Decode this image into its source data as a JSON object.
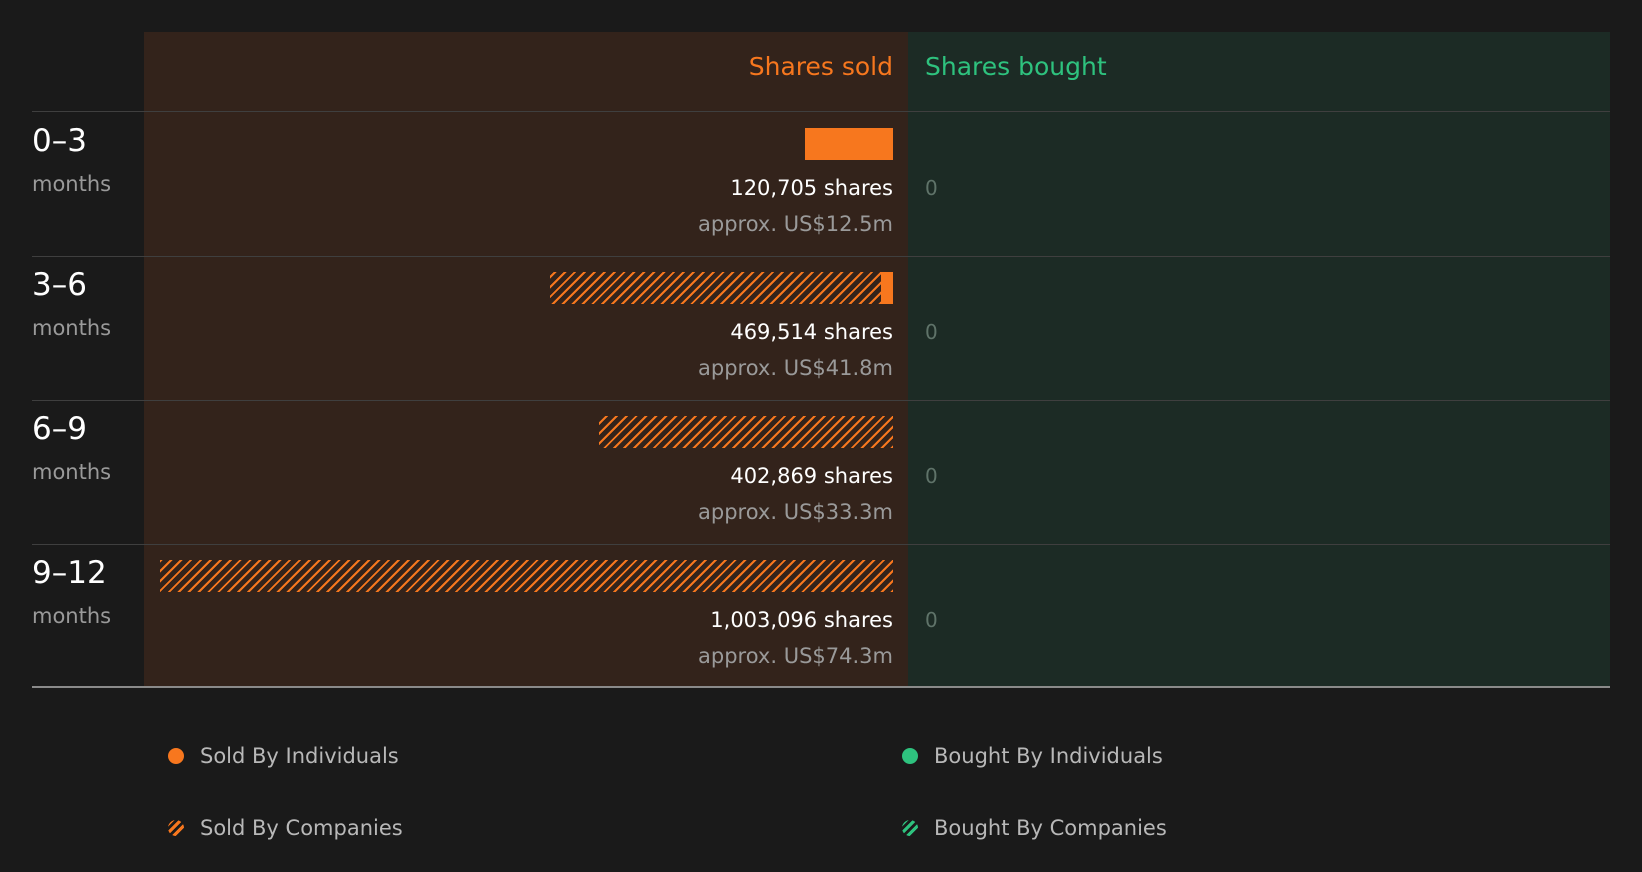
{
  "header": {
    "sold_label": "Shares sold",
    "bought_label": "Shares bought"
  },
  "colors": {
    "sold": "#f7771e",
    "bought": "#2ec27e"
  },
  "legend": {
    "sold_individuals": "Sold By Individuals",
    "bought_individuals": "Bought By Individuals",
    "sold_companies": "Sold By Companies",
    "bought_companies": "Bought By Companies"
  },
  "chart_data": {
    "type": "bar",
    "categories": [
      "0–3",
      "3–6",
      "6–9",
      "9–12"
    ],
    "category_unit": "months",
    "series": [
      {
        "name": "Sold By Individuals",
        "values": [
          120705,
          17000,
          0,
          0
        ]
      },
      {
        "name": "Sold By Companies",
        "values": [
          0,
          452514,
          402869,
          1003096
        ]
      },
      {
        "name": "Bought By Individuals",
        "values": [
          0,
          0,
          0,
          0
        ]
      },
      {
        "name": "Bought By Companies",
        "values": [
          0,
          0,
          0,
          0
        ]
      }
    ],
    "shares_labels": [
      "120,705 shares",
      "469,514 shares",
      "402,869 shares",
      "1,003,096 shares"
    ],
    "value_labels": [
      "approx. US$12.5m",
      "approx. US$41.8m",
      "approx. US$33.3m",
      "approx. US$74.3m"
    ],
    "bought_labels": [
      "0",
      "0",
      "0",
      "0"
    ]
  }
}
